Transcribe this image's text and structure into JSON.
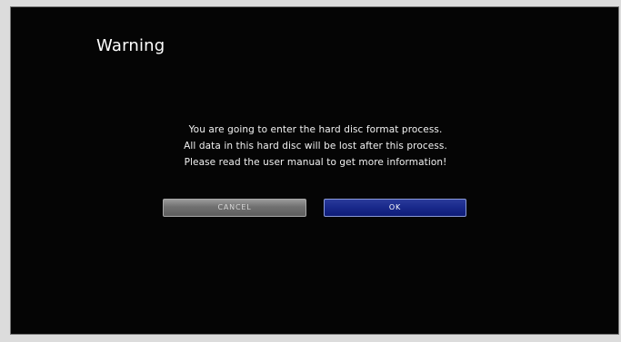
{
  "dialog": {
    "title": "Warning",
    "message_lines": [
      "You are going to enter the hard disc format process.",
      "All data in this hard disc will be lost after this process.",
      "Please read the user manual to get more information!"
    ],
    "cancel_label": "CANCEL",
    "ok_label": "OK"
  },
  "colors": {
    "background": "#050505",
    "ok_button": "#1a2a8c",
    "cancel_button": "#707070"
  }
}
